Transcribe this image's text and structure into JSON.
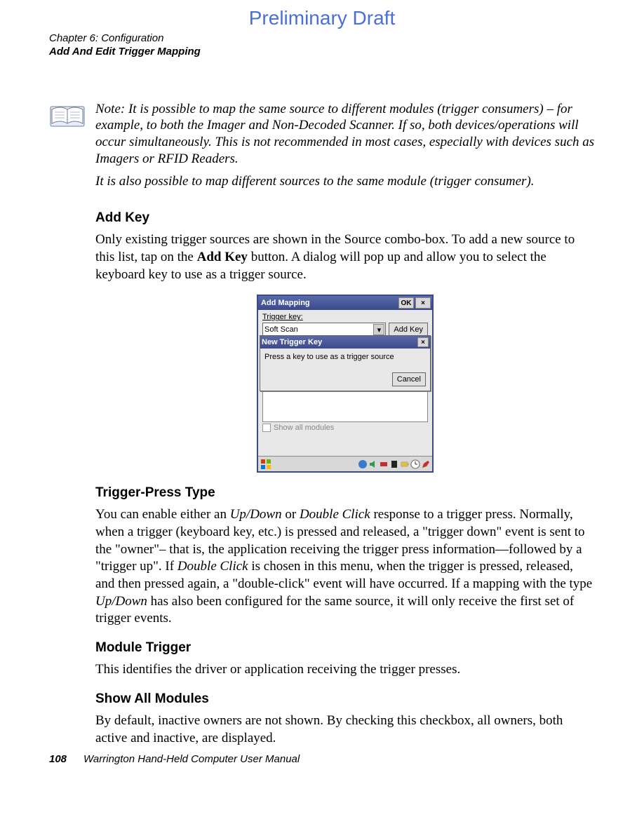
{
  "header": {
    "watermark": "Preliminary Draft",
    "chapter_line": "Chapter 6: Configuration",
    "section_line": "Add And Edit Trigger Mapping"
  },
  "note": {
    "para1": "Note: It is possible to map the same source to different modules (trigger consumers) – for example, to both the Imager and Non-Decoded Scanner. If so, both devices/operations will occur simultaneously. This is not recommended in most cases, especially with devices such as Imagers or RFID Readers.",
    "para2": "It is also possible to map different sources to the same module (trigger consumer)."
  },
  "sections": {
    "add_key": {
      "heading": "Add Key",
      "para_before_bold": "Only existing trigger sources are shown in the Source combo-box. To add a new source to this list, tap on the ",
      "bold": "Add Key",
      "para_after_bold": " button. A dialog will pop up and allow you to select the keyboard key to use as a trigger source."
    },
    "trigger_press": {
      "heading": "Trigger-Press Type",
      "p_seg1": "You can enable either an ",
      "i1": "Up/Down",
      "p_seg2": " or ",
      "i2": "Double Click",
      "p_seg3": " response to a trigger press. Normally, when a trigger (keyboard key, etc.) is pressed and released, a \"trigger down\" event is sent to the \"owner\"– that is, the application receiving the trigger press information—followed by a \"trigger up\". If ",
      "i3": "Double Click",
      "p_seg4": " is chosen in this menu, when the trigger is pressed, released, and then pressed again, a \"double-click\" event will have occurred. If a mapping with the type ",
      "i4": "Up/Down",
      "p_seg5": " has also been configured for the same source, it will only receive the first set of trigger events."
    },
    "module_trigger": {
      "heading": "Module Trigger",
      "para": "This identifies the driver or application receiving the trigger presses."
    },
    "show_all": {
      "heading": "Show All Modules",
      "para": "By default, inactive owners are not shown. By checking this checkbox, all owners, both active and inactive, are displayed."
    }
  },
  "dialog": {
    "outer_title": "Add Mapping",
    "ok": "OK",
    "close": "×",
    "trigger_key_label": "Trigger key:",
    "combo_value": "Soft Scan",
    "add_key_btn": "Add Key",
    "show_all_label": "Show all modules",
    "inner_title": "New Trigger Key",
    "inner_msg": "Press a key to use as a trigger source",
    "cancel": "Cancel"
  },
  "footer": {
    "page": "108",
    "title": "Warrington Hand-Held Computer User Manual"
  }
}
